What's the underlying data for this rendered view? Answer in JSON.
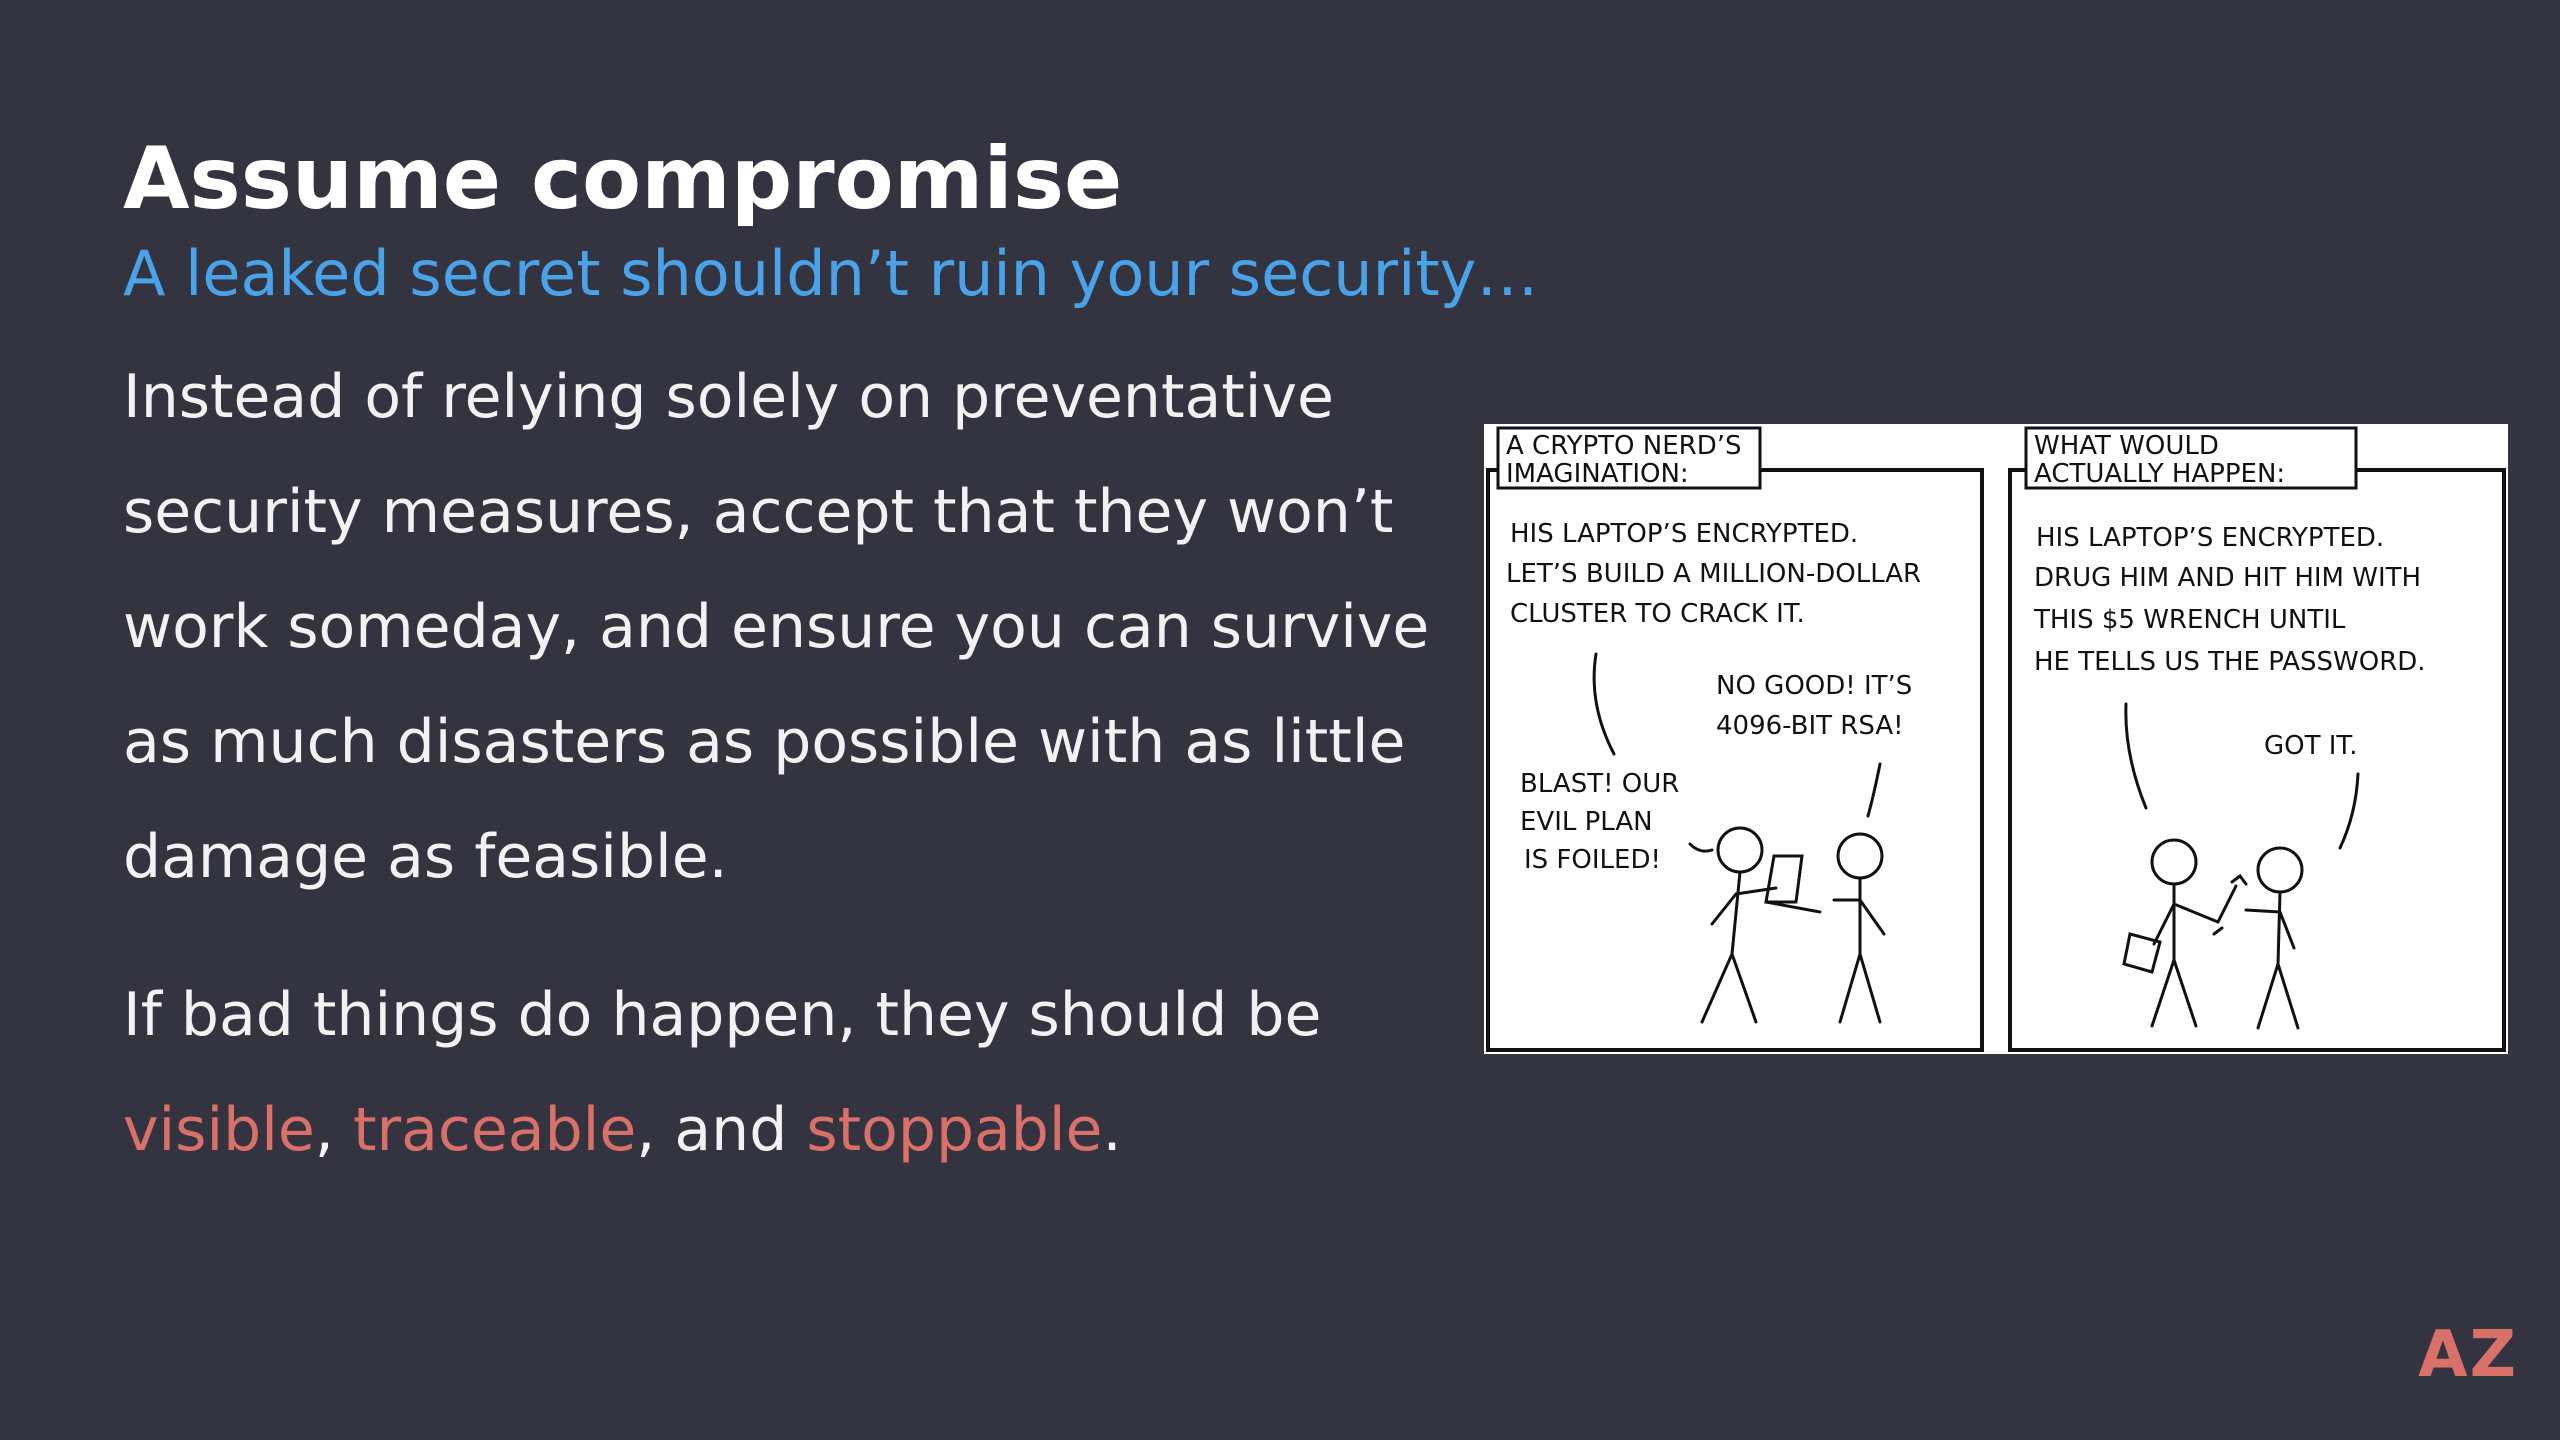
{
  "slide": {
    "title": "Assume compromise",
    "subtitle": "A leaked secret shouldn’t ruin your security…",
    "paragraph1": "Instead of relying solely on preventative security measures, accept that they won’t work someday, and ensure you can survive as much disasters as possible with as little damage as feasible.",
    "paragraph2": {
      "lead": "If bad things do happen, they should be ",
      "word1": "visible",
      "sep1": ", ",
      "word2": "traceable",
      "sep2": ", and ",
      "word3": "stoppable",
      "end": "."
    },
    "logo": "AZ",
    "colors": {
      "background": "#33343f",
      "title": "#ffffff",
      "subtitle": "#4aa3e8",
      "highlight": "#d9706a"
    }
  },
  "comic": {
    "panel1": {
      "caption_line1": "A CRYPTO NERD’S",
      "caption_line2": "IMAGINATION:",
      "line1": "HIS LAPTOP’S ENCRYPTED.",
      "line2": "LET’S BUILD A MILLION-DOLLAR",
      "line3": "CLUSTER TO CRACK IT.",
      "reply1": "NO GOOD! IT’S",
      "reply2": "4096-BIT RSA!",
      "villain1": "BLAST! OUR",
      "villain2": "EVIL PLAN",
      "villain3": "IS FOILED!"
    },
    "panel2": {
      "caption_line1": "WHAT WOULD",
      "caption_line2": "ACTUALLY HAPPEN:",
      "line1": "HIS LAPTOP’S ENCRYPTED.",
      "line2": "DRUG HIM AND HIT HIM WITH",
      "line3": "THIS $5 WRENCH UNTIL",
      "line4": "HE TELLS US THE PASSWORD.",
      "reply": "GOT IT."
    }
  }
}
